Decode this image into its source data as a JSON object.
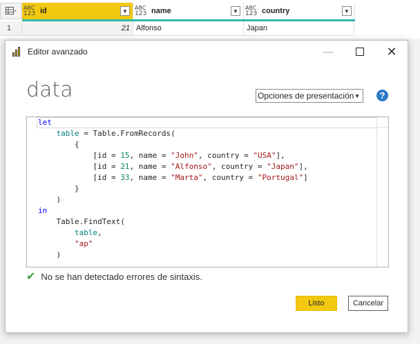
{
  "grid": {
    "columns": [
      {
        "type_top": "ABC",
        "type_bottom": "123",
        "name": "id"
      },
      {
        "type_top": "ABC",
        "type_bottom": "123",
        "name": "name"
      },
      {
        "type_top": "ABC",
        "type_bottom": "123",
        "name": "country"
      }
    ],
    "row": {
      "index": "1",
      "id": "21",
      "name": "Alfonso",
      "country": "Japan"
    }
  },
  "dialog": {
    "title": "Editor avanzado",
    "minimize": "—",
    "close": "✕",
    "query_name": "data",
    "display_options": "Opciones de presentación",
    "help": "?",
    "code": {
      "l1": "let",
      "l2_var": "table",
      "l2_rest": " = Table.FromRecords(",
      "l3": "{",
      "rec1": {
        "pre": "[id = ",
        "num": "15",
        "mid": ", name = ",
        "name": "\"John\"",
        "mid2": ", country = ",
        "country": "\"USA\"",
        "post": "],"
      },
      "rec2": {
        "pre": "[id = ",
        "num": "21",
        "mid": ", name = ",
        "name": "\"Alfonso\"",
        "mid2": ", country = ",
        "country": "\"Japan\"",
        "post": "],"
      },
      "rec3": {
        "pre": "[id = ",
        "num": "33",
        "mid": ", name = ",
        "name": "\"Marta\"",
        "mid2": ", country = ",
        "country": "\"Portugal\"",
        "post": "]"
      },
      "l7": "}",
      "l8": ")",
      "l9": "in",
      "l10": "Table.FindText(",
      "l11_var": "table",
      "l11_rest": ",",
      "l12": "\"ap\"",
      "l13": ")"
    },
    "status": "No se han detectado errores de sintaxis.",
    "ok_label": "Listo",
    "cancel_label": "Cancelar"
  },
  "colors": {
    "accent": "#f2c811",
    "help": "#2b78c7",
    "quality": "#2fb8a8",
    "check": "#3a9c3a"
  }
}
